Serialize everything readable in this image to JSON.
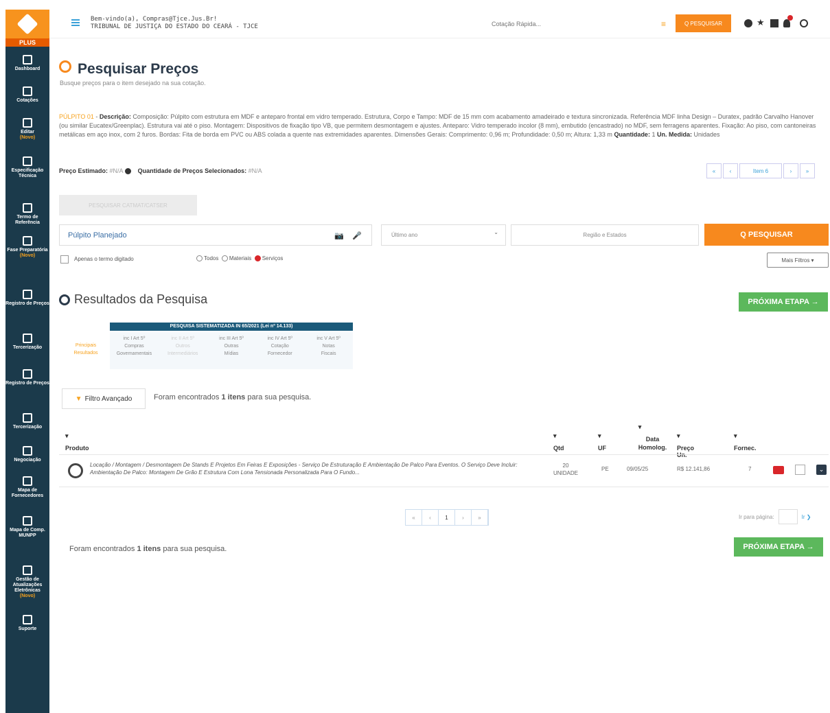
{
  "sidebar": {
    "plus": "PLUS",
    "items": [
      {
        "label": "Dashboard",
        "new": ""
      },
      {
        "label": "Cotações",
        "new": ""
      },
      {
        "label": "Editar",
        "new": "(Novo)"
      },
      {
        "label": "Especificação Técnica",
        "new": ""
      },
      {
        "label": "Termo de Referência",
        "new": ""
      },
      {
        "label": "Fase Preparatória",
        "new": "(Novo)"
      },
      {
        "label": "Registro de Preços",
        "new": ""
      },
      {
        "label": "Tercerização",
        "new": ""
      },
      {
        "label": "Registro de Preços",
        "new": ""
      },
      {
        "label": "Tercerização",
        "new": ""
      },
      {
        "label": "Negociação",
        "new": ""
      },
      {
        "label": "Mapa de Fornecedores",
        "new": ""
      },
      {
        "label": "Mapa de Comp. MUNPP",
        "new": ""
      },
      {
        "label": "Gestão de Atualizações Eletrônicas",
        "new": "(Novo)"
      },
      {
        "label": "Suporte",
        "new": ""
      }
    ]
  },
  "topbar": {
    "welcome_line1": "Bem-vindo(a), Compras@Tjce.Jus.Br!",
    "welcome_line2": "TRIBUNAL DE JUSTIÇA DO ESTADO DO CEARÁ - TJCE",
    "cotacao_placeholder": "Cotação Rápida...",
    "search_button": "Q PESQUISAR"
  },
  "page": {
    "title": "Pesquisar Preços",
    "subtitle": "Busque preços para o item desejado na sua cotação."
  },
  "item": {
    "code": "PÚLPITO 01",
    "desc_label": "Descrição:",
    "description": "Composição: Púlpito com estrutura em MDF e anteparo frontal em vidro temperado. Estrutura, Corpo e Tampo: MDF de 15 mm com acabamento amadeirado e textura sincronizada. Referência MDF linha Design – Duratex, padrão Carvalho Hanover (ou similar Eucatex/Greenplac). Estrutura vai até o piso. Montagem: Dispositivos de fixação tipo VB, que permitem desmontagem e ajustes. Anteparo: Vidro temperado incolor (8 mm), embutido (encastrado) no MDF, sem ferragens aparentes. Fixação: Ao piso, com cantoneiras metálicas em aço inox, com 2 furos. Bordas: Fita de borda em PVC ou ABS colada a quente nas extremidades aparentes. Dimensões Gerais: Comprimento: 0,96 m; Profundidade: 0,50 m; Altura: 1,33 m",
    "qty_label": "Quantidade:",
    "qty": "1",
    "unit_label": "Un. Medida:",
    "unit": "Unidades"
  },
  "preco": {
    "estimado_label": "Preço Estimado:",
    "estimado_value": "#N/A",
    "qtd_label": "Quantidade de Preços Selecionados:",
    "qtd_value": "#N/A"
  },
  "pager_top": {
    "first": "«",
    "prev": "‹",
    "label": "Item 6",
    "next": "›",
    "last": "»"
  },
  "disabled_button": "PESQUISAR CATMAT/CATSER",
  "search": {
    "value": "Púlpito Planejado",
    "year_placeholder": "Último ano",
    "region_placeholder": "Região e Estados",
    "button": "Q PESQUISAR"
  },
  "options": {
    "only_term": "Apenas o termo digitado",
    "radio_todos": "Todos",
    "radio_materiais": "Materiais",
    "radio_servicos": "Serviços",
    "mais_filtros": "Mais Filtros"
  },
  "results": {
    "title": "Resultados da Pesquisa",
    "next_step": "PRÓXIMA ETAPA →",
    "sistem_left": "Principais Resultados",
    "sistem_header": "PESQUISA SISTEMATIZADA IN 65/2021 (Lei nº 14.133)",
    "sistem_cols": [
      {
        "l1": "inc I Art 5º",
        "l2": "Compras",
        "l3": "Governamentais"
      },
      {
        "l1": "inc II Art 5º",
        "l2": "Outros",
        "l3": "Intermediários"
      },
      {
        "l1": "inc III Art 5º",
        "l2": "Outras",
        "l3": "Mídias"
      },
      {
        "l1": "inc IV Art 5º",
        "l2": "Cotação",
        "l3": "Fornecedor"
      },
      {
        "l1": "inc V Art 5º",
        "l2": "Notas",
        "l3": "Fiscais"
      }
    ],
    "filter_button": "Filtro Avançado",
    "found_prefix": "Foram encontrados",
    "found_count": "1 itens",
    "found_suffix": "para sua pesquisa."
  },
  "table": {
    "headers": {
      "produto": "Produto",
      "qtd": "Qtd",
      "uf": "UF",
      "data": "Data Homolog.",
      "preco": "Preço Un.",
      "fornec": "Fornec."
    },
    "rows": [
      {
        "produto": "Locação / Montagem / Desmontagem De Stands E Projetos Em Feiras E Exposições - Serviço De Estruturação E Ambientação De Palco Para Eventos. O Serviço Deve Incluir: Ambientação De Palco: Montagem De Grão E Estrutura Com Lona Tensionada Personalizada Para O Fundo...",
        "qtd": "20",
        "unid": "UNIDADE",
        "uf": "PE",
        "data": "09/05/25",
        "preco": "R$ 12.141,86",
        "fornec": "7"
      }
    ]
  },
  "pager_bottom": {
    "first": "«",
    "prev": "‹",
    "page": "1",
    "next": "›",
    "last": "»"
  },
  "per_page": {
    "label": "Ir para página:",
    "go": "Ir ❯"
  }
}
